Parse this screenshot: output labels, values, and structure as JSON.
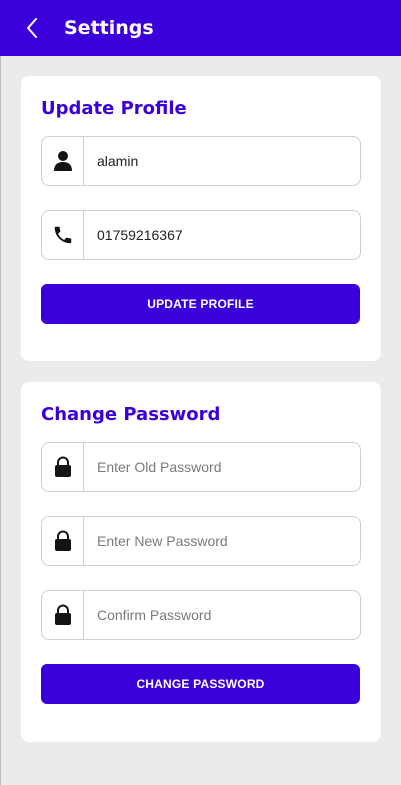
{
  "header": {
    "title": "Settings",
    "back_icon": "chevron-left-icon",
    "background": "#3b00d9"
  },
  "profile": {
    "title": "Update Profile",
    "name": {
      "icon": "user-icon",
      "value": "alamin"
    },
    "phone": {
      "icon": "phone-icon",
      "value": "01759216367"
    },
    "button_label": "UPDATE PROFILE"
  },
  "password": {
    "title": "Change Password",
    "old": {
      "icon": "lock-icon",
      "placeholder": "Enter Old Password"
    },
    "new": {
      "icon": "lock-icon",
      "placeholder": "Enter New Password"
    },
    "confirm": {
      "icon": "lock-icon",
      "placeholder": "Confirm Password"
    },
    "button_label": "CHANGE PASSWORD"
  },
  "colors": {
    "accent": "#3b00d9",
    "background": "#ebebeb",
    "card": "#ffffff",
    "icon": "#141414"
  }
}
